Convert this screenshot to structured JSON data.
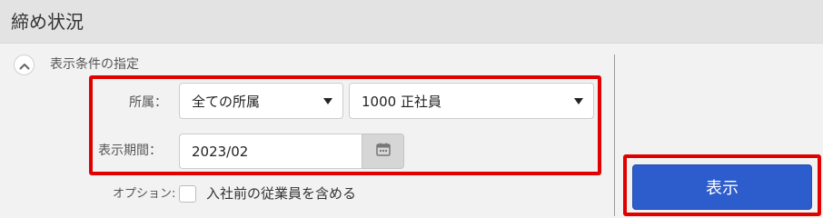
{
  "header": {
    "title": "締め状況"
  },
  "conditions": {
    "toggle_label": "表示条件の指定",
    "toggle_icon": "chevron-up-icon"
  },
  "filters": {
    "affiliation": {
      "label": "所属：",
      "select1_value": "全ての所属",
      "select2_value": "1000 正社員"
    },
    "period": {
      "label": "表示期間：",
      "value": "2023/02",
      "calendar_icon": "calendar-icon"
    },
    "option": {
      "label": "オプション:",
      "checkbox_label": "入社前の従業員を含める",
      "checked": false
    }
  },
  "actions": {
    "display_button": "表示"
  },
  "colors": {
    "highlight": "#e00000",
    "primary": "#2d5ccc",
    "header_bg": "#e3e3e3",
    "page_bg": "#f2f2f2"
  }
}
